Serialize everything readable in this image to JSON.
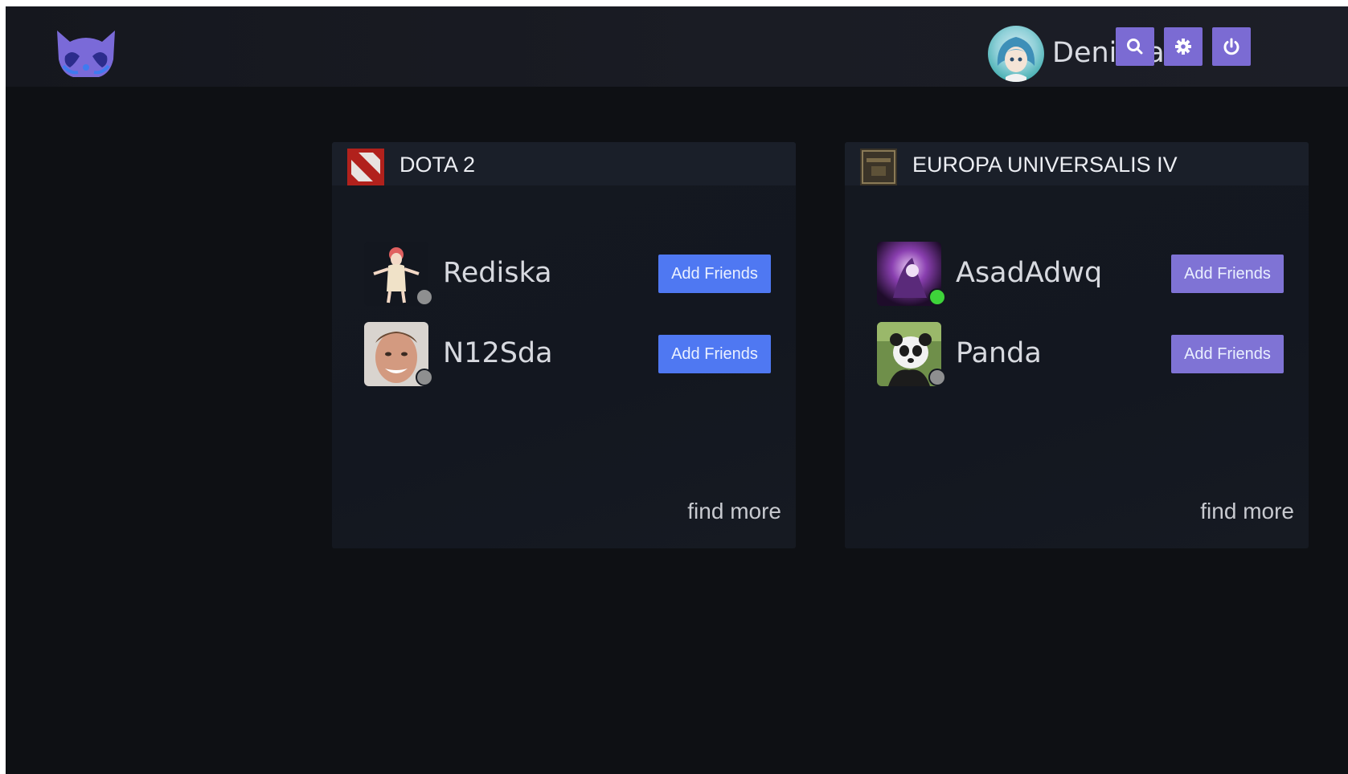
{
  "user": {
    "name": "Deniska"
  },
  "toolbar": {
    "buttons": [
      {
        "icon": "search-icon"
      },
      {
        "icon": "gear-icon"
      },
      {
        "icon": "power-icon"
      }
    ]
  },
  "colors": {
    "accent": "#7b6bd3",
    "button_blue": "#4f78f2",
    "button_purple": "#7f73d5",
    "online": "#3ed33a",
    "offline": "#8e8f90"
  },
  "cards": [
    {
      "game": "DOTA 2",
      "icon": "dota2-logo-icon",
      "players": [
        {
          "name": "Rediska",
          "status": "offline",
          "button": "Add Friends"
        },
        {
          "name": "N12Sda",
          "status": "offline",
          "button": "Add Friends"
        }
      ],
      "find_more": "find more"
    },
    {
      "game": "EUROPA UNIVERSALIS IV",
      "icon": "europa-universalis-logo-icon",
      "players": [
        {
          "name": "AsadAdwq",
          "status": "online",
          "button": "Add Friends"
        },
        {
          "name": "Panda",
          "status": "offline",
          "button": "Add Friends"
        }
      ],
      "find_more": "find more"
    }
  ]
}
